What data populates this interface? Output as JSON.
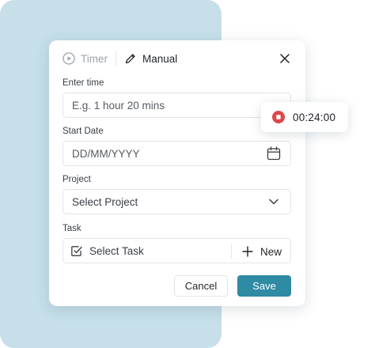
{
  "header": {
    "tabs": [
      {
        "label": "Timer",
        "icon": "play-circle-icon",
        "active": false
      },
      {
        "label": "Manual",
        "icon": "pencil-icon",
        "active": true
      }
    ],
    "close_icon": "close-icon"
  },
  "fields": {
    "time": {
      "label": "Enter time",
      "placeholder": "E.g. 1 hour 20 mins",
      "value": ""
    },
    "start_date": {
      "label": "Start Date",
      "placeholder": "DD/MM/YYYY",
      "icon": "calendar-icon"
    },
    "project": {
      "label": "Project",
      "value": "Select Project",
      "icon": "chevron-down-icon"
    },
    "task": {
      "label": "Task",
      "value": "Select Task",
      "new_label": "New",
      "icon": "checkbox-icon"
    }
  },
  "actions": {
    "cancel_label": "Cancel",
    "save_label": "Save"
  },
  "timer_chip": {
    "time": "00:24:00",
    "icon": "stop-record-icon"
  },
  "colors": {
    "accent": "#2f8aa3",
    "background_panel": "#c6dfe9",
    "stop_red": "#e0474c"
  }
}
